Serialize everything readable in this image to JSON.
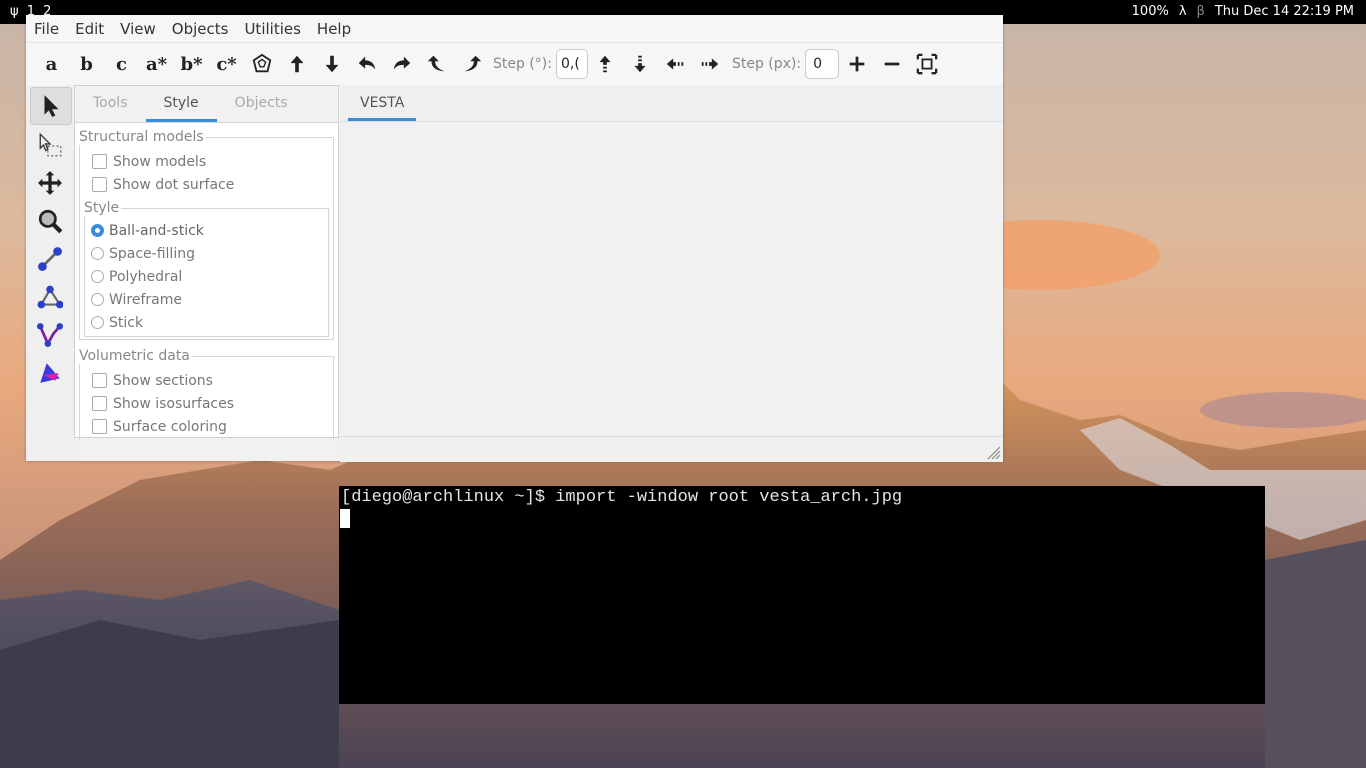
{
  "topbar": {
    "workspaces": "ψ 1 2",
    "battery": "100%",
    "lambda": "λ",
    "beta": "β",
    "datetime": "Thu Dec 14  22:19 PM"
  },
  "vesta": {
    "menu": [
      "File",
      "Edit",
      "View",
      "Objects",
      "Utilities",
      "Help"
    ],
    "toolbar": {
      "axes": [
        "a",
        "b",
        "c",
        "a*",
        "b*",
        "c*"
      ],
      "step_deg_label": "Step (°):",
      "step_deg_value": "0,(",
      "step_px_label": "Step (px):",
      "step_px_value": "0"
    },
    "tabs": [
      "Tools",
      "Style",
      "Objects"
    ],
    "active_tab": "Style",
    "structural_models": {
      "title": "Structural models",
      "options": [
        "Show models",
        "Show dot surface"
      ],
      "style": {
        "title": "Style",
        "options": [
          "Ball-and-stick",
          "Space-filling",
          "Polyhedral",
          "Wireframe",
          "Stick"
        ],
        "selected": "Ball-and-stick"
      }
    },
    "volumetric": {
      "title": "Volumetric data",
      "options": [
        "Show sections",
        "Show isosurfaces",
        "Surface coloring"
      ]
    },
    "document_tab": "VESTA"
  },
  "terminal": {
    "prompt_line": "[diego@archlinux ~]$ import -window root vesta_arch.jpg"
  },
  "colors": {
    "accent": "#3b8bd8",
    "terminal_bg": "#000000"
  }
}
